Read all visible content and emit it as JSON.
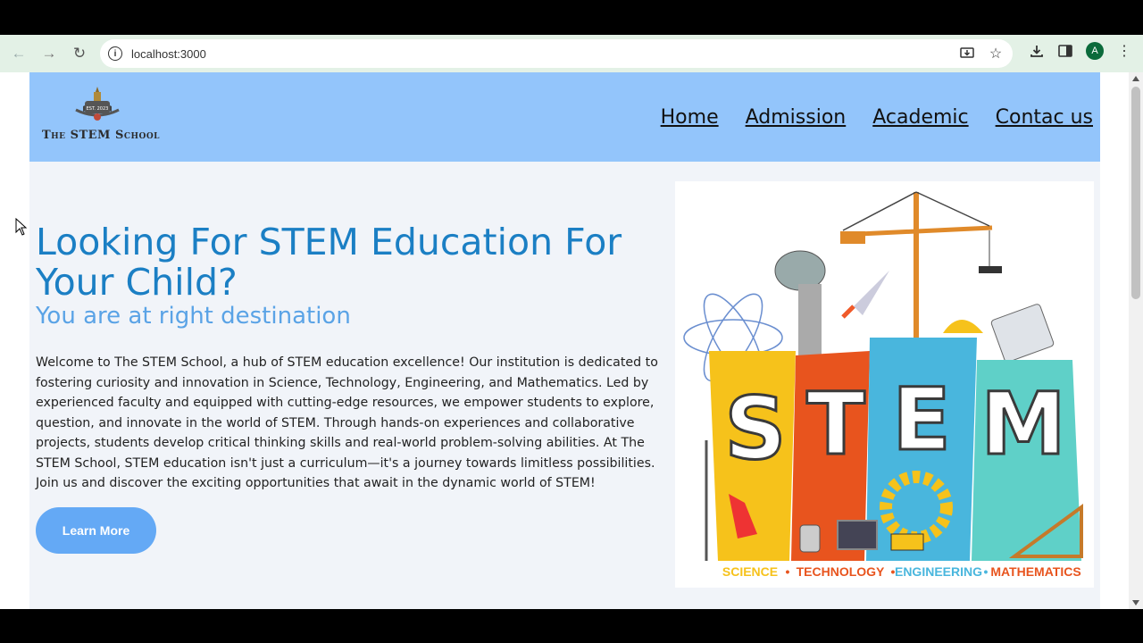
{
  "browser": {
    "url": "localhost:3000",
    "profile_initial": "A",
    "icons": [
      "back-icon",
      "forward-icon",
      "reload-icon",
      "site-info-icon",
      "install-icon",
      "bookmark-star-icon",
      "download-icon",
      "side-panel-icon",
      "profile-avatar",
      "menu-kebab-icon"
    ]
  },
  "site": {
    "logo_badge": "EST. 2023",
    "logo_text": "The STEM School",
    "nav": [
      "Home",
      "Admission",
      "Academic",
      "Contac us"
    ],
    "hero_title": "Looking For STEM Education For Your Child?",
    "hero_subtitle": "You are at right destination",
    "hero_body": "Welcome to The STEM School, a hub of STEM education excellence! Our institution is dedicated to fostering curiosity and innovation in Science, Technology, Engineering, and Mathematics. Led by experienced faculty and equipped with cutting-edge resources, we empower students to explore, question, and innovate in the world of STEM. Through hands-on experiences and collaborative projects, students develop critical thinking skills and real-world problem-solving abilities. At The STEM School, STEM education isn't just a curriculum—it's a journey towards limitless possibilities. Join us and discover the exciting opportunities that await in the dynamic world of STEM!",
    "cta": "Learn More",
    "illustration": {
      "letters": [
        "S",
        "T",
        "E",
        "M"
      ],
      "caption": [
        "SCIENCE",
        "TECHNOLOGY",
        "ENGINEERING",
        "MATHEMATICS"
      ],
      "caption_sep": "•"
    }
  },
  "colors": {
    "header_bg": "#93c5fb",
    "title": "#1b7fc4",
    "subtitle": "#5aa3e6",
    "button": "#64a9f5"
  }
}
